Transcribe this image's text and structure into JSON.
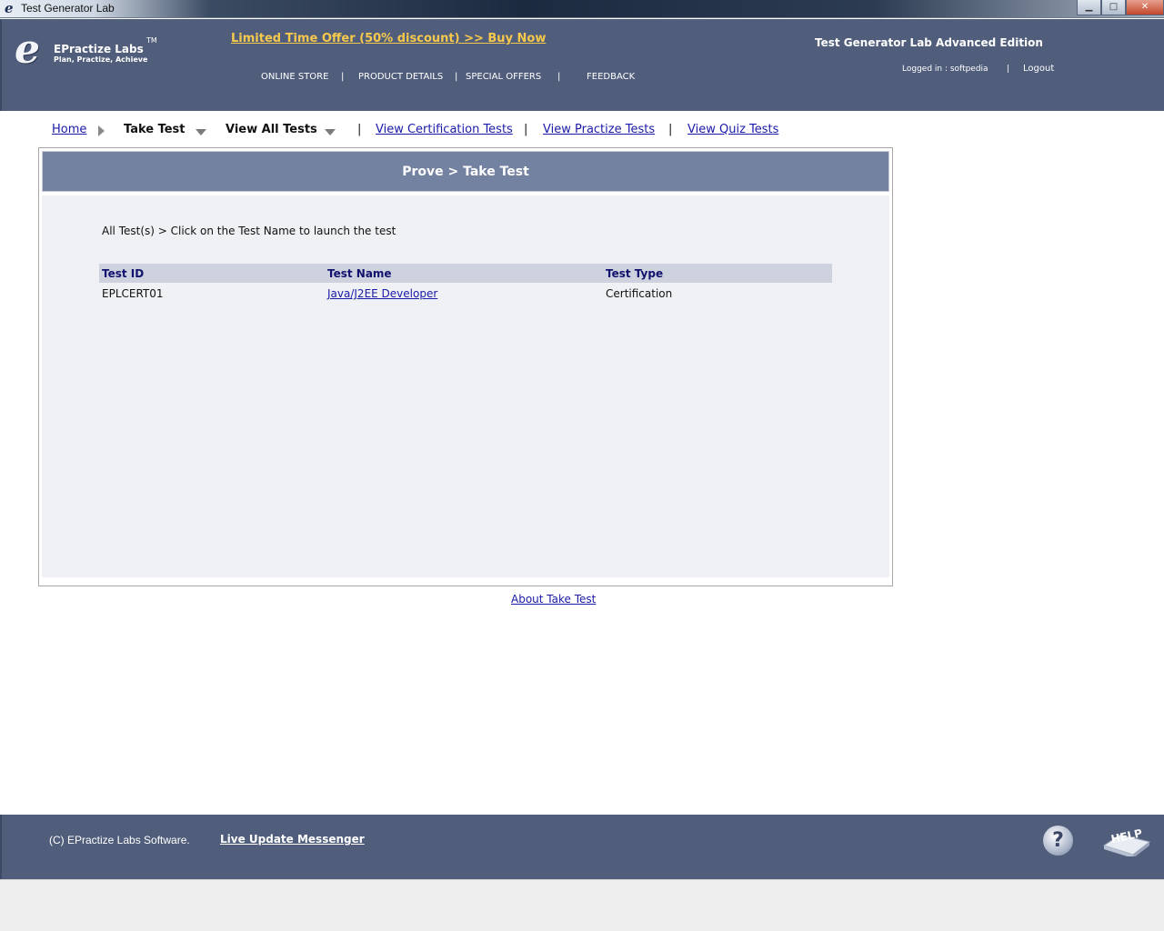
{
  "window": {
    "title": "Test Generator Lab",
    "controls": [
      "minimize",
      "maximize",
      "close"
    ]
  },
  "header": {
    "logo_name": "EPractize Labs",
    "logo_tm": "TM",
    "logo_tagline": "Plan, Practize, Achieve",
    "offer": "Limited Time Offer (50% discount) >> Buy Now",
    "nav": [
      "ONLINE STORE",
      "PRODUCT DETAILS",
      "SPECIAL OFFERS",
      "FEEDBACK"
    ],
    "edition": "Test Generator Lab Advanced Edition",
    "logged_in": "Logged in : softpedia",
    "logout": "Logout"
  },
  "subnav": {
    "home": "Home",
    "take_test": "Take Test",
    "view_all_tests": "View All Tests",
    "view_certification": "View Certification Tests",
    "view_practize": "View Practize Tests",
    "view_quiz": "View Quiz Tests",
    "separator": "|"
  },
  "panel": {
    "title": "Prove > Take Test",
    "instruction": "All Test(s) > Click on the Test Name to launch the test",
    "columns": [
      "Test ID",
      "Test Name",
      "Test Type"
    ],
    "rows": [
      {
        "id": "EPLCERT01",
        "name": "Java/J2EE Developer",
        "type": "Certification"
      }
    ]
  },
  "about_link": "About Take Test",
  "footer": {
    "copyright": "(C) EPractize Labs Software.",
    "live_update": "Live Update Messenger",
    "help_icon_label": "HELP"
  },
  "colors": {
    "header_bg": "#505e7c",
    "panel_head_bg": "#7482a2",
    "link": "#1a1aa8",
    "offer": "#f7c94c"
  }
}
